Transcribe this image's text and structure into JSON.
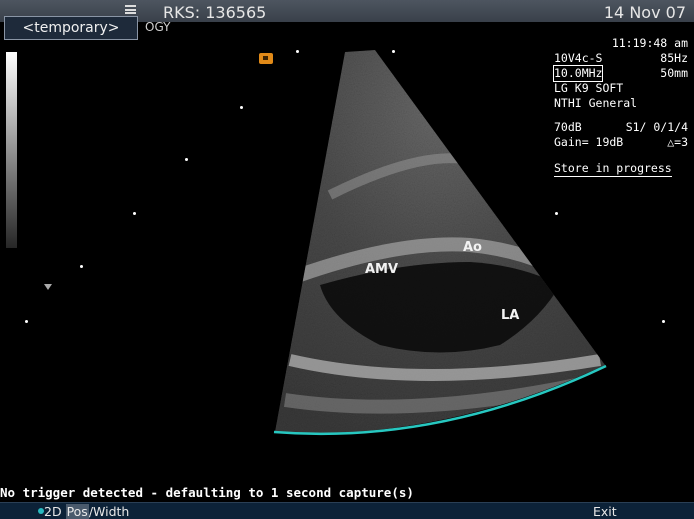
{
  "header": {
    "temporary_tag": "<temporary>",
    "patient_id": "RKS: 136565",
    "department": "OGY",
    "date": "14 Nov 07"
  },
  "params": {
    "time": "11:19:48 am",
    "probe": "10V4c-S",
    "frame_rate": "85Hz",
    "frequency": "10.0MHz",
    "depth": "50mm",
    "preset": "LG K9 SOFT",
    "institution": "NTHI General",
    "dynamic_range": "70dB",
    "setting": "S1/ 0/1/4",
    "gain": "Gain= 19dB",
    "delta": "△=3",
    "store_status": "Store in progress"
  },
  "annotations": {
    "amv": "AMV",
    "ao": "Ao",
    "la": "LA"
  },
  "status": {
    "message": "No trigger detected - defaulting to 1 second capture(s)"
  },
  "bottom": {
    "mode_prefix": "2D",
    "pos": "Pos",
    "mode_suffix": "/Width",
    "exit": "Exit"
  },
  "colors": {
    "sector_arc": "#27c7c0",
    "orientation_marker": "#e18a18",
    "bottom_bar": "#0c2238"
  }
}
